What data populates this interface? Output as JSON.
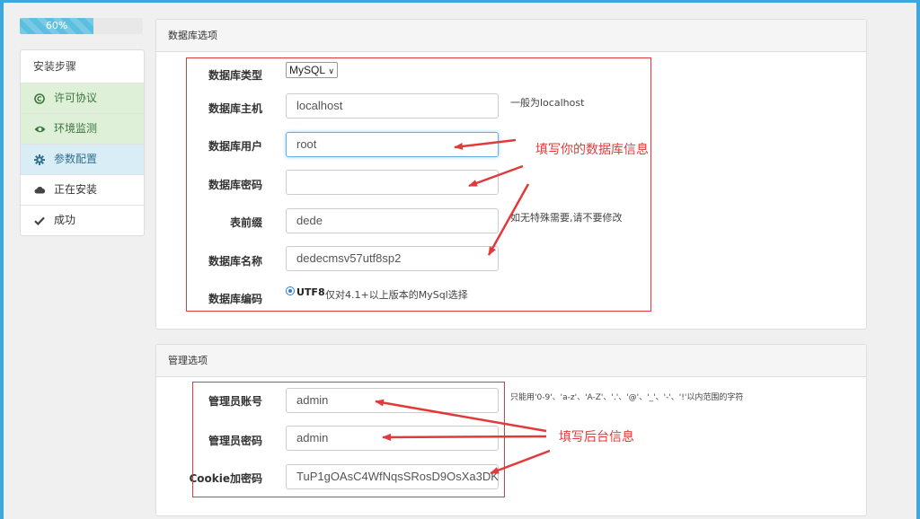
{
  "progress": {
    "percent_label": "60%",
    "value": 0.6
  },
  "steps": {
    "title": "安装步骤",
    "items": [
      {
        "label": "许可协议",
        "icon": "copyright-icon",
        "state": "done"
      },
      {
        "label": "环境监测",
        "icon": "eye-icon",
        "state": "done"
      },
      {
        "label": "参数配置",
        "icon": "gear-icon",
        "state": "active"
      },
      {
        "label": "正在安装",
        "icon": "cloud-icon",
        "state": "pending"
      },
      {
        "label": "成功",
        "icon": "check-icon",
        "state": "pending"
      }
    ]
  },
  "db_panel": {
    "title": "数据库选项",
    "type_label": "数据库类型",
    "type_value": "MySQL",
    "host_label": "数据库主机",
    "host_value": "localhost",
    "host_hint": "一般为localhost",
    "user_label": "数据库用户",
    "user_value": "root",
    "password_label": "数据库密码",
    "password_value": "",
    "prefix_label": "表前缀",
    "prefix_value": "dede",
    "prefix_hint": "如无特殊需要,请不要修改",
    "name_label": "数据库名称",
    "name_value": "dedecmsv57utf8sp2",
    "encoding_label": "数据库编码",
    "encoding_value": "UTF8",
    "encoding_hint": "仅对4.1+以上版本的MySql选择"
  },
  "admin_panel": {
    "title": "管理选项",
    "account_label": "管理员账号",
    "account_value": "admin",
    "account_hint": "只能用'0-9'、'a-z'、'A-Z'、'.'、'@'、'_'、'-'、'!'以内范围的字符",
    "password_label": "管理员密码",
    "password_value": "admin",
    "cookie_label": "Cookie加密码",
    "cookie_value": "TuP1gOAsC4WfNqsSRosD9OsXa3DK"
  },
  "annotations": {
    "db_note": "填写你的数据库信息",
    "admin_note": "填写后台信息",
    "color": "#e03b3b"
  }
}
